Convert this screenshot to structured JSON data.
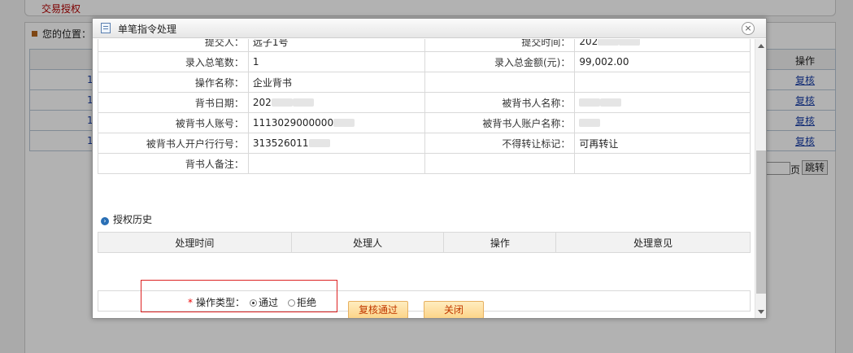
{
  "background": {
    "top_tab": "交易授权",
    "breadcrumb_label": "您的位置：",
    "op_header": "操作",
    "rows": [
      {
        "num": "1",
        "op": "复核"
      },
      {
        "num": "1",
        "op": "复核"
      },
      {
        "num": "1",
        "op": "复核"
      },
      {
        "num": "1",
        "op": "复核"
      }
    ],
    "pager": {
      "page_label": "页",
      "go_label": "跳转"
    }
  },
  "dialog": {
    "title": "单笔指令处理",
    "close_glyph": "×",
    "info": {
      "submitter_label": "提交人：",
      "submitter_value": "远子1号",
      "submit_time_label": "提交时间：",
      "submit_time_value": "202",
      "count_label": "录入总笔数：",
      "count_value": "1",
      "amount_label": "录入总金额(元)：",
      "amount_value": "99,002.00",
      "opname_label": "操作名称：",
      "opname_value": "企业背书",
      "empty_label": "",
      "empty_value": "",
      "date_label": "背书日期：",
      "date_value": "202",
      "endorsee_name_label": "被背书人名称：",
      "endorsee_name_value": "",
      "endorsee_acct_label": "被背书人账号：",
      "endorsee_acct_value": "1113029000000",
      "endorsee_acct_name_label": "被背书人账户名称：",
      "endorsee_acct_name_value": "",
      "bank_no_label": "被背书人开户行行号：",
      "bank_no_value": "313526011",
      "transfer_flag_label": "不得转让标记：",
      "transfer_flag_value": "可再转让",
      "remark_label": "背书人备注：",
      "remark_value": ""
    },
    "history": {
      "section_title": "授权历史",
      "columns": [
        "处理时间",
        "处理人",
        "操作",
        "处理意见"
      ]
    },
    "operation": {
      "required_mark": "*",
      "label": "操作类型：",
      "options": [
        "通过",
        "拒绝"
      ],
      "selected": "通过"
    },
    "buttons": {
      "approve": "复核通过",
      "close": "关闭"
    }
  },
  "colors": {
    "highlight_box": "#dd2222",
    "link": "#1a3fa8",
    "button_text": "#c03800",
    "section_bullet": "#2a6fb5"
  }
}
